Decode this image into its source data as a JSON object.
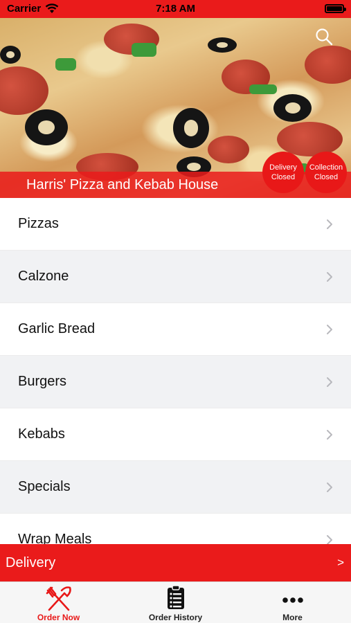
{
  "status_bar": {
    "carrier": "Carrier",
    "time": "7:18 AM",
    "wifi_icon": "wifi-icon",
    "battery_icon": "battery-icon"
  },
  "hero": {
    "restaurant_name": "Harris' Pizza and Kebab House",
    "search_icon": "search-icon",
    "delivery_status_line1": "Delivery",
    "delivery_status_line2": "Closed",
    "collection_status_line1": "Collection",
    "collection_status_line2": "Closed"
  },
  "categories": [
    {
      "label": "Pizzas"
    },
    {
      "label": "Calzone"
    },
    {
      "label": "Garlic Bread"
    },
    {
      "label": "Burgers"
    },
    {
      "label": "Kebabs"
    },
    {
      "label": "Specials"
    },
    {
      "label": "Wrap Meals"
    }
  ],
  "delivery_bar": {
    "label": "Delivery",
    "arrow": ">"
  },
  "tab_bar": {
    "tabs": [
      {
        "label": "Order Now",
        "icon": "fork-knife-icon",
        "active": true
      },
      {
        "label": "Order History",
        "icon": "clipboard-icon",
        "active": false
      },
      {
        "label": "More",
        "icon": "more-dots-icon",
        "active": false
      }
    ]
  },
  "colors": {
    "brand_red": "#ea1b1b",
    "list_alt_bg": "#f1f2f4",
    "tab_bar_bg": "#f6f6f6"
  }
}
